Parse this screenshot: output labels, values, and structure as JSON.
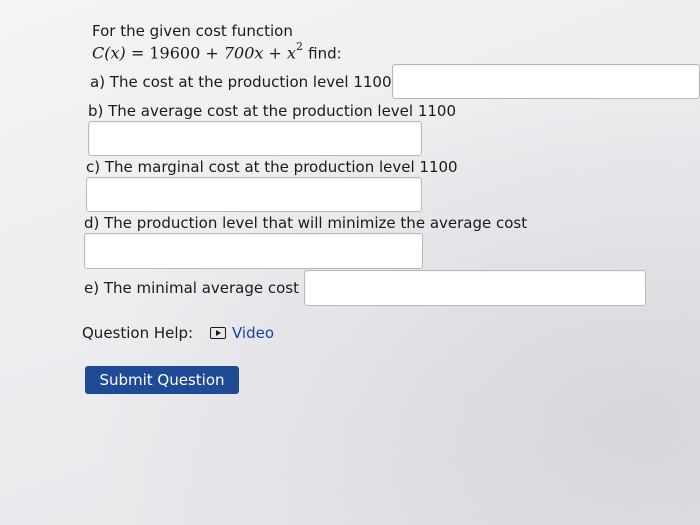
{
  "problem": {
    "intro": "For the given cost function",
    "function_lhs": "C(x)",
    "function_rhs_const": "19600",
    "function_rhs_linear": "700x",
    "function_rhs_square_base": "x",
    "function_rhs_square_exp": "2",
    "find_text": "find:"
  },
  "questions": {
    "a": "a) The cost at the production level 1100",
    "b": "b) The average cost at the production level 1100",
    "c": "c) The marginal cost at the production level 1100",
    "d": "d) The production level that will minimize the average cost",
    "e": "e) The minimal average cost"
  },
  "answers": {
    "a": "",
    "b": "",
    "c": "",
    "d": "",
    "e": ""
  },
  "help": {
    "label": "Question Help:",
    "video_icon": "play-video-icon",
    "video_label": "Video"
  },
  "submit": {
    "label": "Submit Question",
    "color": "#1e4a96"
  },
  "colors": {
    "link": "#1c3fa8"
  }
}
